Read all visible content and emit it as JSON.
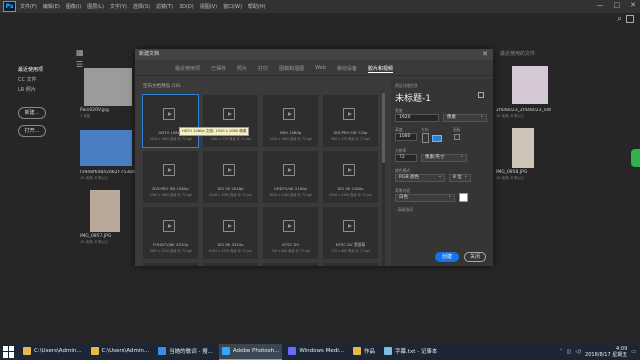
{
  "app": {
    "logo": "Ps"
  },
  "menu": [
    "文件(F)",
    "编辑(E)",
    "图像(I)",
    "图层(L)",
    "文字(Y)",
    "选择(S)",
    "滤镜(T)",
    "3D(D)",
    "视图(V)",
    "窗口(W)",
    "帮助(H)"
  ],
  "window_controls": [
    "—",
    "□",
    "✕"
  ],
  "home": {
    "left_nav": [
      "最近使用项",
      "CC 文件",
      "LR 照片"
    ],
    "btn_new": "新建...",
    "btn_open": "打开...",
    "recent": [
      {
        "name": "Pain020V.jpg",
        "sub": "7 天前"
      },
      {
        "name": "f3948f64842d62f-7538d8...",
        "sub": "10 天前, 8 张以上"
      },
      {
        "name": "IMG_0957.JPG",
        "sub": "10 天前, 8 张以上"
      },
      {
        "name": "2f448023_2f448023_SWI...",
        "sub": "10 天前, 8 张以上"
      },
      {
        "name": "IMG_0958.JPG",
        "sub": "10 天前, 8 张以上"
      }
    ],
    "sort_label": "最近使用的文件"
  },
  "dialog": {
    "title": "新建文档",
    "close": "✕",
    "tabs": [
      "最近使用项",
      "已保存",
      "照片",
      "打印",
      "图稿和插图",
      "Web",
      "移动设备",
      "胶片和视频"
    ],
    "active_tab_index": 7,
    "section_title": "空白文档预设 (16)",
    "tooltip": "HDTV 1080p 文档: 1920 x 1080 像素",
    "presets": [
      {
        "name": "HDTV 1080p",
        "size": "1920 x 1080 像素 @ 72 ppi"
      },
      {
        "name": "HDTV 720p",
        "size": "1280 x 720 像素 @ 72 ppi"
      },
      {
        "name": "HDV 1080p",
        "size": "1440 x 1080 像素 @ 72 ppi"
      },
      {
        "name": "DVCPRO HD 720p",
        "size": "960 x 720 像素 @ 72 ppi"
      },
      {
        "name": "DVCPRO HD 1080p",
        "size": "1280 x 1080 像素 @ 72 ppi"
      },
      {
        "name": "DCI 2K 2048p",
        "size": "2048 x 1080 像素 @ 72 ppi"
      },
      {
        "name": "UHDTV/4K 2160p",
        "size": "3840 x 2160 像素 @ 72 ppi"
      },
      {
        "name": "DCI 4K 2160p",
        "size": "4096 x 2160 像素 @ 72 ppi"
      },
      {
        "name": "FUHDTV/8K 4320p",
        "size": "7680 x 4320 像素 @ 72 ppi"
      },
      {
        "name": "DCI 8K 4320p",
        "size": "8192 x 4320 像素 @ 72 ppi"
      },
      {
        "name": "NTSC DV",
        "size": "720 x 480 像素 @ 72 ppi"
      },
      {
        "name": "NTSC DV 宽银幕",
        "size": "720 x 480 像素 @ 72 ppi"
      }
    ],
    "details": {
      "header": "预设详细信息",
      "doc_name": "未标题-1",
      "width_label": "宽度",
      "width": "1920",
      "width_unit": "像素",
      "height_label": "高度",
      "height": "1080",
      "orientation_label": "方向",
      "artboard_label": "画板",
      "resolution_label": "分辨率",
      "resolution": "72",
      "resolution_unit": "像素/英寸",
      "color_mode_label": "颜色模式",
      "color_mode": "RGB 颜色",
      "bit_depth": "8 位",
      "background_label": "背景内容",
      "background": "白色",
      "advanced": "高级选项"
    },
    "btn_create": "创建",
    "btn_close": "关闭"
  },
  "taskbar": {
    "items": [
      {
        "label": "C:\\Users\\Admin...",
        "color": "#e8b84a"
      },
      {
        "label": "C:\\Users\\Admin...",
        "color": "#e8b84a"
      },
      {
        "label": "当她的歌词 - 搜...",
        "color": "#3a8ee6"
      },
      {
        "label": "Adobe Photosh...",
        "color": "#31a8ff"
      },
      {
        "label": "Windows Medi...",
        "color": "#6a6aff"
      },
      {
        "label": "作品",
        "color": "#e8b84a"
      },
      {
        "label": "字幕.txt - 记事本",
        "color": "#7cc0e8"
      }
    ],
    "active_index": 3,
    "time": "4:09",
    "date": "2018/8/17 星期五"
  }
}
